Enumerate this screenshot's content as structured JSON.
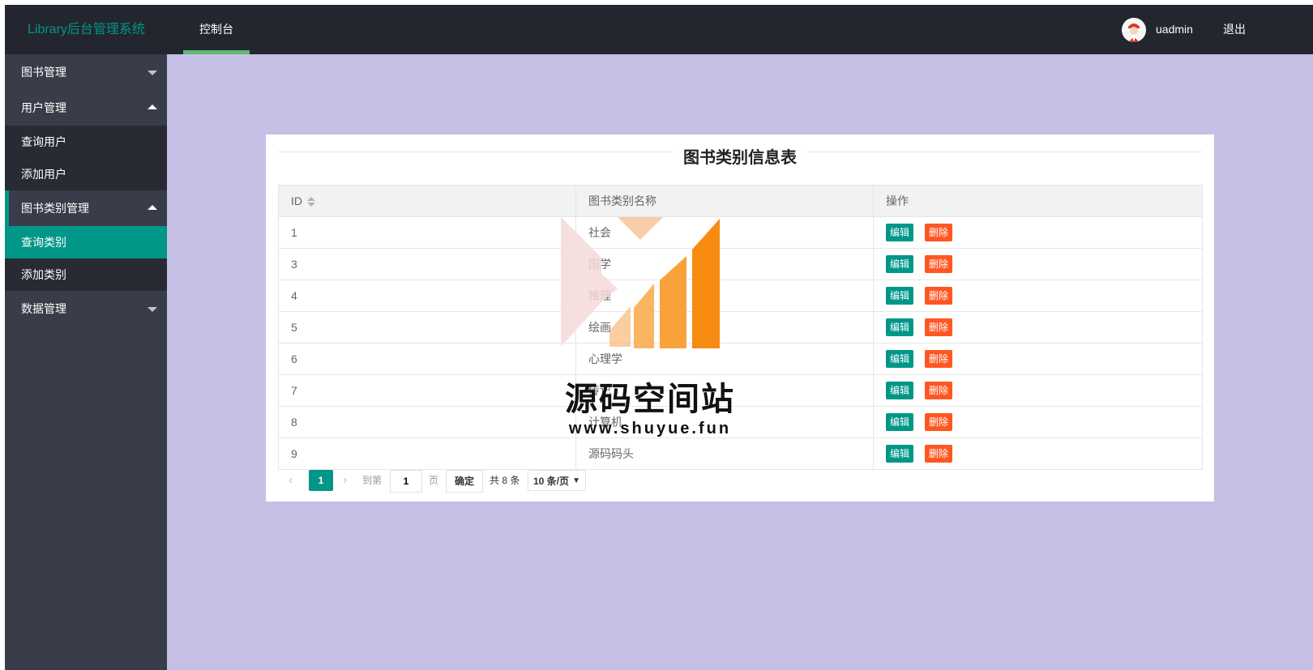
{
  "app": {
    "title": "Library后台管理系统"
  },
  "top_nav": {
    "items": [
      {
        "label": "控制台"
      }
    ]
  },
  "user": {
    "name": "uadmin",
    "logout_label": "退出"
  },
  "sidebar": {
    "groups": [
      {
        "label": "图书管理",
        "expanded": false,
        "children": []
      },
      {
        "label": "用户管理",
        "expanded": true,
        "children": [
          {
            "label": "查询用户"
          },
          {
            "label": "添加用户"
          }
        ]
      },
      {
        "label": "图书类别管理",
        "expanded": true,
        "children": [
          {
            "label": "查询类别",
            "selected": true
          },
          {
            "label": "添加类别"
          }
        ]
      },
      {
        "label": "数据管理",
        "expanded": false,
        "children": []
      }
    ]
  },
  "table": {
    "title": "图书类别信息表",
    "columns": [
      "ID",
      "图书类别名称",
      "操作"
    ],
    "rows": [
      {
        "id": "1",
        "name": "社会"
      },
      {
        "id": "3",
        "name": "国学"
      },
      {
        "id": "4",
        "name": "推理"
      },
      {
        "id": "5",
        "name": "绘画"
      },
      {
        "id": "6",
        "name": "心理学"
      },
      {
        "id": "7",
        "name": "传记"
      },
      {
        "id": "8",
        "name": "计算机"
      },
      {
        "id": "9",
        "name": "源码码头"
      }
    ],
    "edit_label": "编辑",
    "delete_label": "删除"
  },
  "pager": {
    "current_page": "1",
    "goto_label": "到第",
    "goto_value": "1",
    "page_label": "页",
    "confirm_label": "确定",
    "total_label": "共 8 条",
    "page_size": "10 条/页"
  },
  "watermark": {
    "title": "源码空间站",
    "url": "www.shuyue.fun"
  },
  "colors": {
    "header_bg": "#23262e",
    "sidebar_bg": "#393d49",
    "accent": "#009688",
    "danger": "#ff5722",
    "main_bg": "#c5bfe5"
  }
}
